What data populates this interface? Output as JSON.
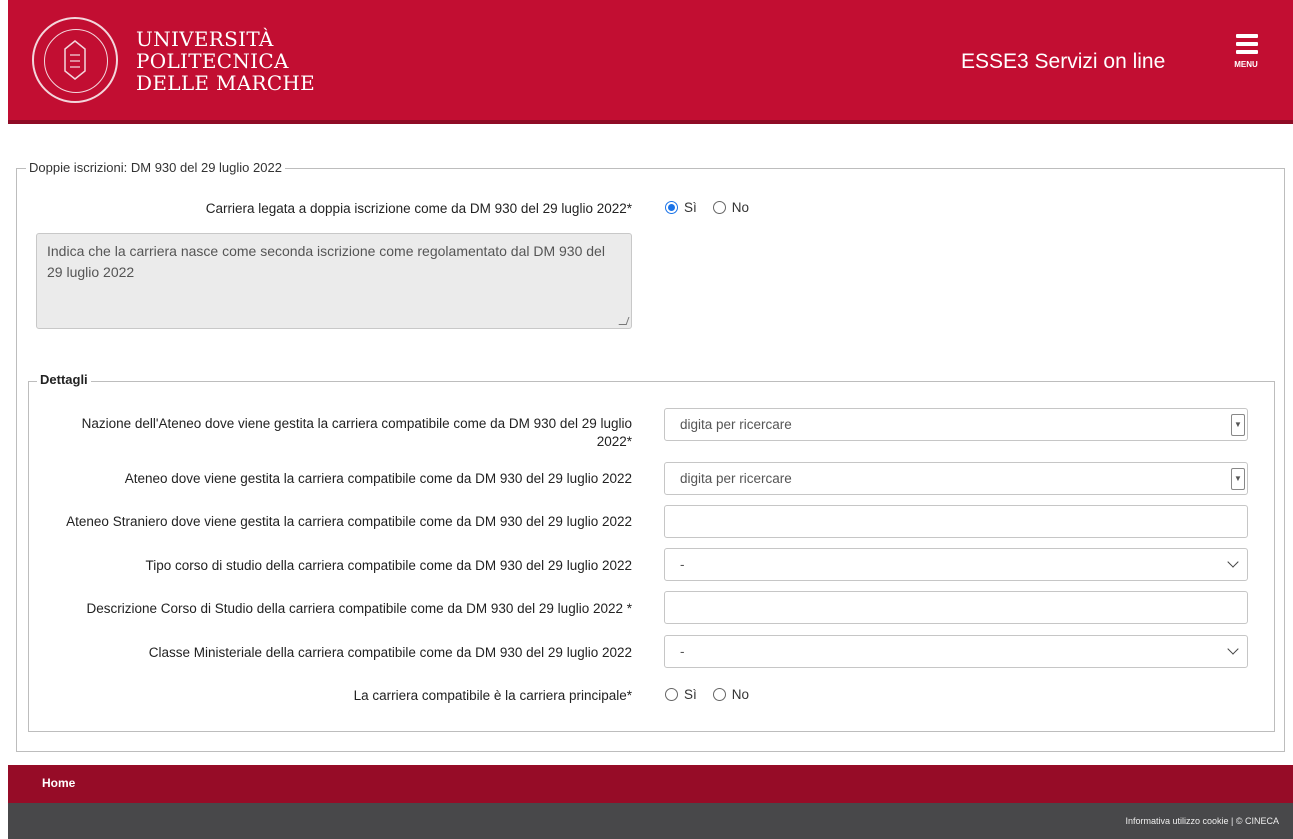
{
  "header": {
    "logo_line1": "UNIVERSITÀ",
    "logo_line2": "POLITECNICA",
    "logo_line3": "DELLE MARCHE",
    "app_title": "ESSE3 Servizi on line",
    "menu_label": "MENU",
    "bg_color": "#c20e32"
  },
  "form": {
    "section_legend": "Doppie iscrizioni: DM 930 del 29 luglio 2022",
    "main_question": "Carriera legata a doppia iscrizione come da DM 930 del 29 luglio 2022*",
    "main_options": [
      "Sì",
      "No"
    ],
    "main_selected": "Sì",
    "info_text": "Indica che la carriera nasce come seconda iscrizione come regolamentato dal DM 930 del 29 luglio 2022",
    "details": {
      "legend": "Dettagli",
      "fields": [
        {
          "label": "Nazione dell'Ateneo dove viene gestita la carriera compatibile come da DM 930 del 29 luglio 2022*",
          "type": "combobox",
          "placeholder": "digita per ricercare"
        },
        {
          "label": "Ateneo dove viene gestita la carriera compatibile come da DM 930 del 29 luglio 2022",
          "type": "combobox",
          "placeholder": "digita per ricercare"
        },
        {
          "label": "Ateneo Straniero dove viene gestita la carriera compatibile come da DM 930 del 29 luglio 2022",
          "type": "text",
          "value": ""
        },
        {
          "label": "Tipo corso di studio della carriera compatibile come da DM 930 del 29 luglio 2022",
          "type": "select",
          "value": "-"
        },
        {
          "label": "Descrizione Corso di Studio della carriera compatibile come da DM 930 del 29 luglio 2022 *",
          "type": "text",
          "value": ""
        },
        {
          "label": "Classe Ministeriale della carriera compatibile come da DM 930 del 29 luglio 2022",
          "type": "select",
          "value": "-"
        },
        {
          "label": "La carriera compatibile è la carriera principale*",
          "type": "radio",
          "options": [
            "Sì",
            "No"
          ],
          "selected": null
        }
      ]
    }
  },
  "footer": {
    "home_link": "Home",
    "links_text": "Informativa utilizzo cookie | © CINECA"
  }
}
